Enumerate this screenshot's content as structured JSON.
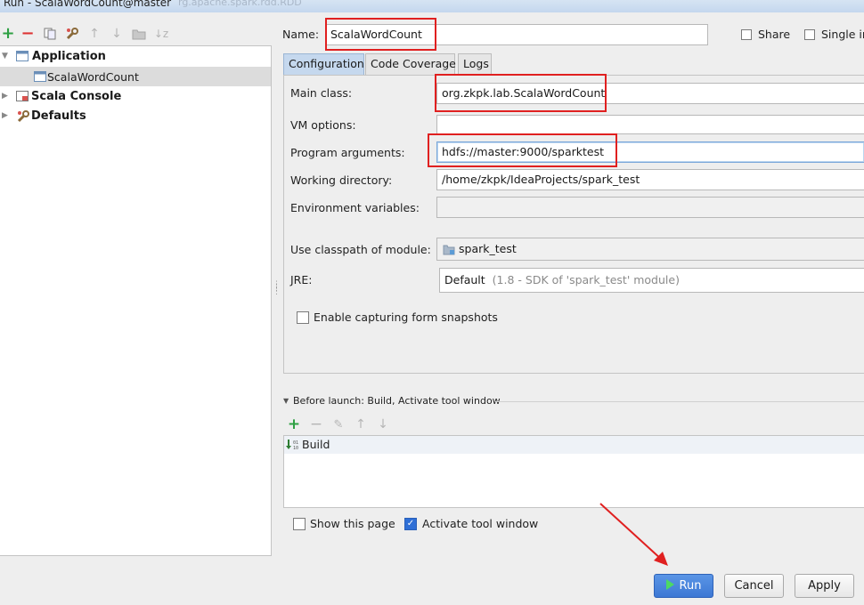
{
  "window": {
    "title": "Run - ScalaWordCount@master",
    "ghost_text": "rg.apache.spark.rdd.RDD"
  },
  "toolbar": {
    "icons": [
      "add-icon",
      "remove-icon",
      "copy-icon",
      "wrench-icon",
      "move-up-icon",
      "move-down-icon",
      "folder-icon",
      "sort-icon"
    ]
  },
  "tree": {
    "items": [
      {
        "label": "Application",
        "bold": true
      },
      {
        "label": "ScalaWordCount",
        "bold": false
      },
      {
        "label": "Scala Console",
        "bold": true
      },
      {
        "label": "Defaults",
        "bold": true
      }
    ]
  },
  "header": {
    "name_label": "Name:",
    "name_value": "ScalaWordCount",
    "share_label": "Share",
    "single_label": "Single in"
  },
  "tabs": [
    {
      "label": "Configuration",
      "active": true
    },
    {
      "label": "Code Coverage",
      "active": false
    },
    {
      "label": "Logs",
      "active": false
    }
  ],
  "config": {
    "main_class_label": "Main class:",
    "main_class_value": "org.zkpk.lab.ScalaWordCount",
    "vm_options_label": "VM options:",
    "vm_options_value": "",
    "program_args_label": "Program arguments:",
    "program_args_value": "hdfs://master:9000/sparktest",
    "working_dir_label": "Working directory:",
    "working_dir_value": "/home/zkpk/IdeaProjects/spark_test",
    "env_vars_label": "Environment variables:",
    "env_vars_value": "",
    "classpath_label": "Use classpath of module:",
    "classpath_value": "spark_test",
    "jre_label": "JRE:",
    "jre_value": "Default",
    "jre_hint": "(1.8 - SDK of 'spark_test' module)",
    "snapshots_label": "Enable capturing form snapshots"
  },
  "before_launch": {
    "header": "Before launch: Build, Activate tool window",
    "items": [
      "Build"
    ]
  },
  "options": {
    "show_page_label": "Show this page",
    "show_page_checked": false,
    "activate_label": "Activate tool window",
    "activate_checked": true
  },
  "buttons": {
    "run": "Run",
    "cancel": "Cancel",
    "apply": "Apply"
  },
  "colors": {
    "annotation_red": "#e02020",
    "primary_blue": "#3d78d4",
    "add_green": "#2ea043",
    "remove_red": "#d33"
  }
}
